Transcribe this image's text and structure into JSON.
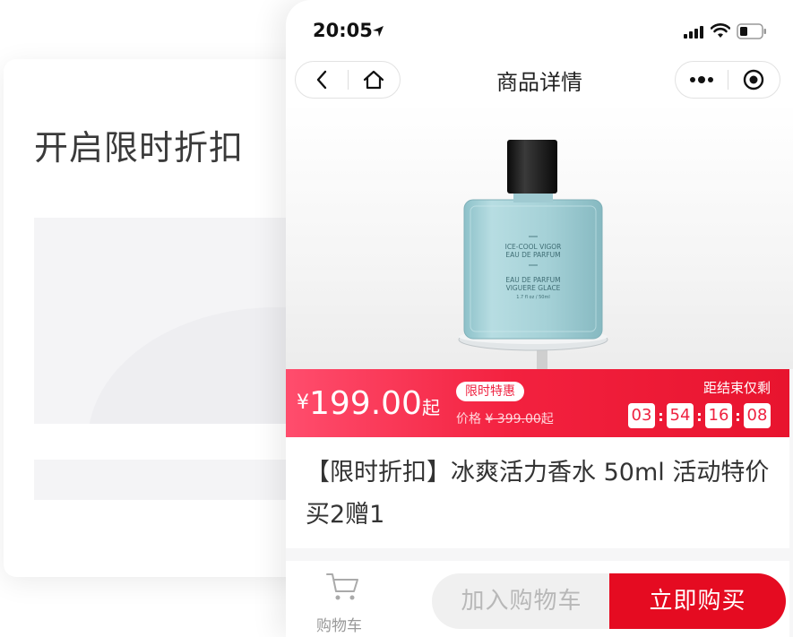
{
  "background": {
    "title": "开启限时折扣"
  },
  "status_bar": {
    "time": "20:05",
    "icons": [
      "location-arrow-icon",
      "signal-icon",
      "wifi-icon",
      "battery-icon"
    ]
  },
  "nav": {
    "title": "商品详情",
    "left_icons": [
      "back-icon",
      "home-icon"
    ],
    "right_icons": [
      "more-icon",
      "record-icon"
    ]
  },
  "product": {
    "bottle_text": [
      "ICE-COOL VIGOR",
      "EAU DE PARFUM",
      "EAU DE PARFUM",
      "VIGUERE GLACE",
      "1.7 fl oz / 50ml"
    ],
    "title": "【限时折扣】冰爽活力香水 50ml 活动特价 买2赠1"
  },
  "promo": {
    "currency": "¥",
    "price": "199.00",
    "price_suffix": "起",
    "tag": "限时特惠",
    "original_label": "价格",
    "original_price": "¥ 399.00",
    "original_suffix": "起",
    "countdown_label": "距结束仅剩",
    "countdown": [
      "03",
      "54",
      "16",
      "08"
    ]
  },
  "bottom_bar": {
    "cart_label": "购物车",
    "add_to_cart": "加入购物车",
    "buy_now": "立即购买"
  },
  "colors": {
    "accent_red": "#e50b21",
    "promo_gradient_start": "#ff4d6d",
    "bottle_glass": "#a9d4da"
  }
}
